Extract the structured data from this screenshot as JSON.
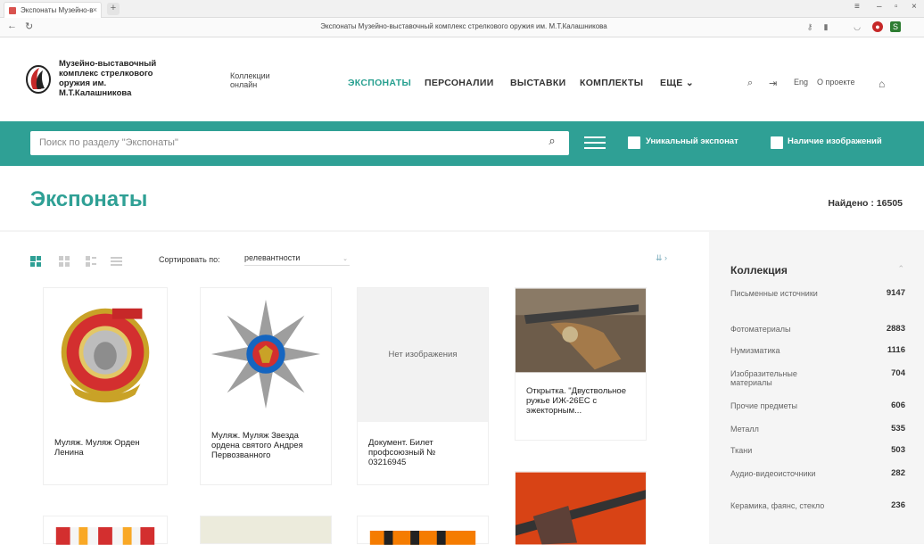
{
  "browser": {
    "tab_title": "Экспонаты Музейно-в",
    "url": "Экспонаты Музейно-выставочный комплекс стрелкового оружия им. М.Т.Калашникова"
  },
  "header": {
    "logo_lines": [
      "Музейно-выставочный",
      "комплекс стрелкового",
      "оружия им.",
      "М.Т.Калашникова"
    ],
    "collections_link": [
      "Коллекции",
      "онлайн"
    ],
    "nav": [
      "ЭКСПОНАТЫ",
      "ПЕРСОНАЛИИ",
      "ВЫСТАВКИ",
      "КОМПЛЕКТЫ",
      "ЕЩЕ"
    ],
    "lang": "Eng",
    "about": "О проекте"
  },
  "search": {
    "placeholder": "Поиск по разделу \"Экспонаты\"",
    "filter_unique": "Уникальный экспонат",
    "filter_images": "Наличие изображений"
  },
  "page": {
    "title": "Экспонаты",
    "found_label": "Найдено :",
    "found_count": "16505"
  },
  "toolbar": {
    "sort_label": "Сортировать по:",
    "sort_value": "релевантности"
  },
  "cards": [
    {
      "caption": "Муляж. Муляж Орден Ленина",
      "image": "medal-lenin"
    },
    {
      "caption": "Муляж. Муляж Звезда ордена святого Андрея Первозванного",
      "image": "star-andrew"
    },
    {
      "caption": "Документ. Билет профсоюзный № 03216945",
      "image": "none",
      "no_image_text": "Нет изображения"
    },
    {
      "caption": "Открытка. \"Двуствольное ружье ИЖ-26ЕС с эжекторным...",
      "image": "shotgun"
    }
  ],
  "sidebar": {
    "title": "Коллекция",
    "items": [
      {
        "name": "Письменные источники",
        "count": "9147"
      },
      {
        "name": "Фотоматериалы",
        "count": "2883"
      },
      {
        "name": "Нумизматика",
        "count": "1116"
      },
      {
        "name": "Изобразительные материалы",
        "count": "704"
      },
      {
        "name": "Прочие предметы",
        "count": "606"
      },
      {
        "name": "Металл",
        "count": "535"
      },
      {
        "name": "Ткани",
        "count": "503"
      },
      {
        "name": "Аудио-видеоисточники",
        "count": "282"
      },
      {
        "name": "Керамика, фаянс, стекло",
        "count": "236"
      }
    ]
  },
  "colors": {
    "accent": "#2fa095",
    "nav_active": "#28a090",
    "sidebar_bg": "#f5f5f5"
  }
}
